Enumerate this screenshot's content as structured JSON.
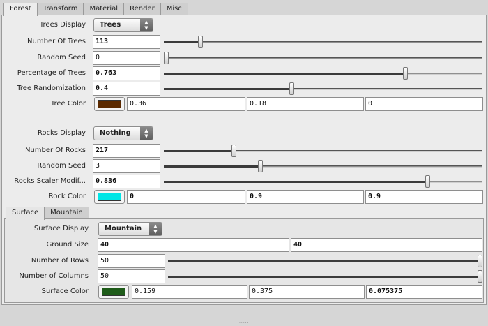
{
  "tabs": [
    {
      "label": "Forest",
      "active": true
    },
    {
      "label": "Transform",
      "active": false
    },
    {
      "label": "Material",
      "active": false
    },
    {
      "label": "Render",
      "active": false
    },
    {
      "label": "Misc",
      "active": false
    }
  ],
  "trees": {
    "display": {
      "label": "Trees Display",
      "value": "Trees"
    },
    "number": {
      "label": "Number Of Trees",
      "value": "113",
      "slider_fraction": 0.11
    },
    "seed": {
      "label": "Random Seed",
      "value": "0",
      "slider_fraction": 0.0
    },
    "percentage": {
      "label": "Percentage of Trees",
      "value": "0.763",
      "slider_fraction": 0.763
    },
    "randomization": {
      "label": "Tree Randomization",
      "value": "0.4",
      "slider_fraction": 0.4
    },
    "color": {
      "label": "Tree Color",
      "swatch": "#5c2a00",
      "r": "0.36",
      "g": "0.18",
      "b": "0"
    }
  },
  "rocks": {
    "display": {
      "label": "Rocks Display",
      "value": "Nothing"
    },
    "number": {
      "label": "Number Of Rocks",
      "value": "217",
      "slider_fraction": 0.217
    },
    "seed": {
      "label": "Random Seed",
      "value": "3",
      "slider_fraction": 0.3
    },
    "scaler": {
      "label": "Rocks Scaler Modif...",
      "value": "0.836",
      "slider_fraction": 0.836
    },
    "color": {
      "label": "Rock Color",
      "swatch": "#00e6e6",
      "r": "0",
      "g": "0.9",
      "b": "0.9"
    }
  },
  "subtabs": [
    {
      "label": "Surface",
      "active": true
    },
    {
      "label": "Mountain",
      "active": false
    }
  ],
  "surface": {
    "display": {
      "label": "Surface Display",
      "value": "Mountain"
    },
    "ground_size": {
      "label": "Ground Size",
      "x": "40",
      "y": "40"
    },
    "rows": {
      "label": "Number of Rows",
      "value": "50",
      "slider_fraction": 1.0
    },
    "columns": {
      "label": "Number of Columns",
      "value": "50",
      "slider_fraction": 1.0
    },
    "color": {
      "label": "Surface Color",
      "swatch": "#1f5c1a",
      "r": "0.159",
      "g": "0.375",
      "b": "0.075375"
    }
  },
  "icons": {
    "dropdown": "updown-arrows-icon",
    "resize": "resize-grip-icon"
  },
  "glyphs": {
    "up": "▲",
    "down": "▼",
    "grip": "·····"
  }
}
